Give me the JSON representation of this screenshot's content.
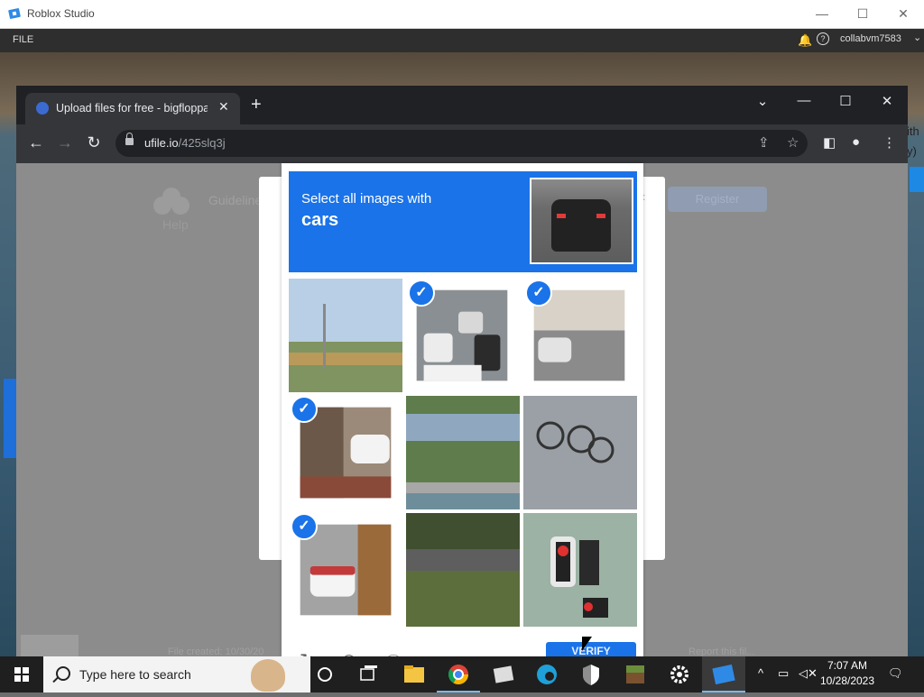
{
  "studio": {
    "title": "Roblox Studio",
    "menu_file": "FILE",
    "username": "collabvm7583",
    "help_glyph": "?",
    "more_glyph": "⌄",
    "right_edge_text": "ith\ny)"
  },
  "browser": {
    "tab_title": "Upload files for free - bigfloppa.",
    "url_host": "ufile.io",
    "url_path": "/425slq3j"
  },
  "page": {
    "help_label": "Help",
    "nav_text": "Guidelines",
    "register_label": "Register",
    "file_created_text": "File created: 10/30/20",
    "report_text": "Report this fil..."
  },
  "captcha": {
    "prompt": "Select all images with",
    "subject": "cars",
    "verify_label": "VERIFY",
    "tiles": [
      {
        "name": "tile-street-lamp-field",
        "selected": false
      },
      {
        "name": "tile-traffic-jam",
        "selected": true
      },
      {
        "name": "tile-road-underpass",
        "selected": true
      },
      {
        "name": "tile-house-car",
        "selected": true
      },
      {
        "name": "tile-overpass-trees",
        "selected": false
      },
      {
        "name": "tile-bicycles",
        "selected": false
      },
      {
        "name": "tile-garage-car",
        "selected": true
      },
      {
        "name": "tile-trees-roof",
        "selected": false
      },
      {
        "name": "tile-traffic-lights",
        "selected": false
      }
    ]
  },
  "taskbar": {
    "search_placeholder": "Type here to search",
    "time": "7:07 AM",
    "date": "10/28/2023"
  },
  "colors": {
    "hcaptcha_blue": "#1a73e8",
    "chrome_dark": "#202124",
    "chrome_toolbar": "#35363a",
    "taskbar": "#1f1f1f"
  }
}
